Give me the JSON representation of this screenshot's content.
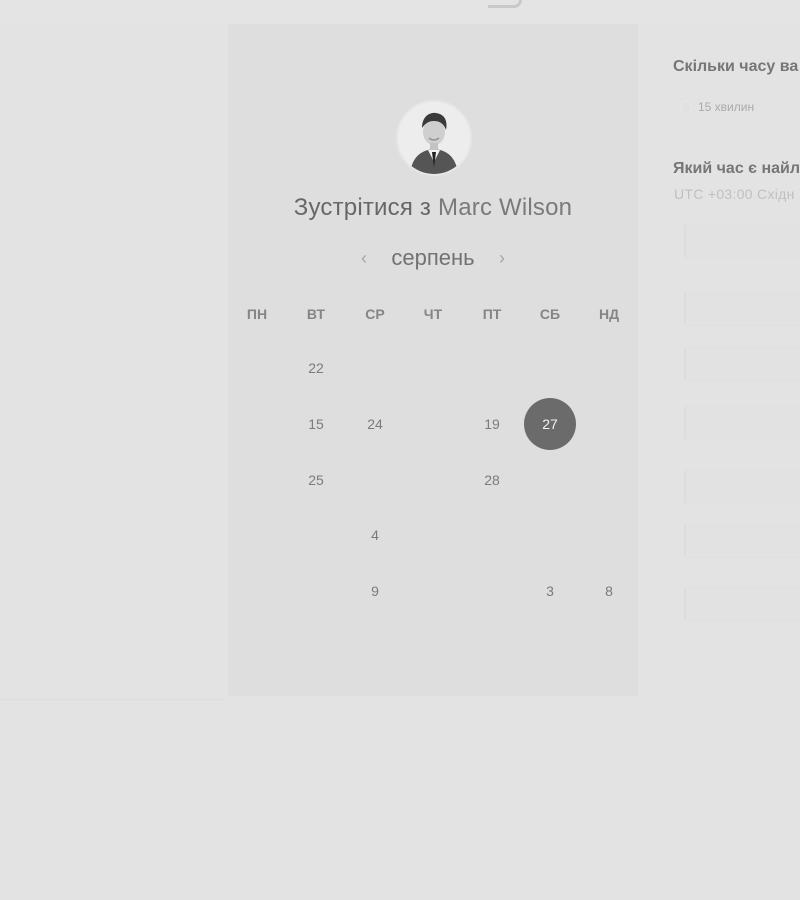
{
  "calendar": {
    "heading_prefix": "Зустрітися з",
    "heading_name": "Marc Wilson",
    "month": "серпень",
    "prev_icon": "‹",
    "next_icon": "›",
    "weekdays": [
      "ПН",
      "ВТ",
      "СР",
      "ЧТ",
      "ПТ",
      "СБ",
      "НД"
    ],
    "weeks": [
      [
        {
          "label": "",
          "state": "disabled"
        },
        {
          "label": "22",
          "state": "available"
        },
        {
          "label": "",
          "state": "disabled"
        },
        {
          "label": "",
          "state": "disabled"
        },
        {
          "label": "",
          "state": "disabled"
        },
        {
          "label": "",
          "state": "disabled"
        },
        {
          "label": "",
          "state": "disabled"
        }
      ],
      [
        {
          "label": "",
          "state": "disabled"
        },
        {
          "label": "15",
          "state": "available"
        },
        {
          "label": "24",
          "state": "available"
        },
        {
          "label": "",
          "state": "disabled"
        },
        {
          "label": "19",
          "state": "available"
        },
        {
          "label": "27",
          "state": "selected"
        },
        {
          "label": "",
          "state": "disabled"
        }
      ],
      [
        {
          "label": "",
          "state": "disabled"
        },
        {
          "label": "25",
          "state": "available"
        },
        {
          "label": "",
          "state": "disabled"
        },
        {
          "label": "",
          "state": "disabled"
        },
        {
          "label": "28",
          "state": "available"
        },
        {
          "label": "",
          "state": "disabled"
        },
        {
          "label": "",
          "state": "disabled"
        }
      ],
      [
        {
          "label": "",
          "state": "disabled"
        },
        {
          "label": "",
          "state": "disabled"
        },
        {
          "label": "4",
          "state": "available"
        },
        {
          "label": "",
          "state": "disabled"
        },
        {
          "label": "",
          "state": "disabled"
        },
        {
          "label": "",
          "state": "disabled"
        },
        {
          "label": "",
          "state": "disabled"
        }
      ],
      [
        {
          "label": "",
          "state": "disabled"
        },
        {
          "label": "",
          "state": "disabled"
        },
        {
          "label": "9",
          "state": "available"
        },
        {
          "label": "",
          "state": "disabled"
        },
        {
          "label": "",
          "state": "disabled"
        },
        {
          "label": "3",
          "state": "available"
        },
        {
          "label": "8",
          "state": "available"
        }
      ]
    ]
  },
  "options": {
    "duration_question": "Скільки часу ва",
    "duration_selected": "15 хвилин",
    "time_question": "Який час є найл",
    "timezone": "UTC +03:00 Східн",
    "time_slots": [
      {},
      {},
      {},
      {},
      {},
      {},
      {}
    ]
  },
  "colors": {
    "background": "#e3e3e3",
    "card": "#dedede",
    "selected_day": "#6b6b6b"
  },
  "icons": {
    "avatar": "person-photo",
    "prev_month": "chevron-left-icon",
    "next_month": "chevron-right-icon"
  }
}
